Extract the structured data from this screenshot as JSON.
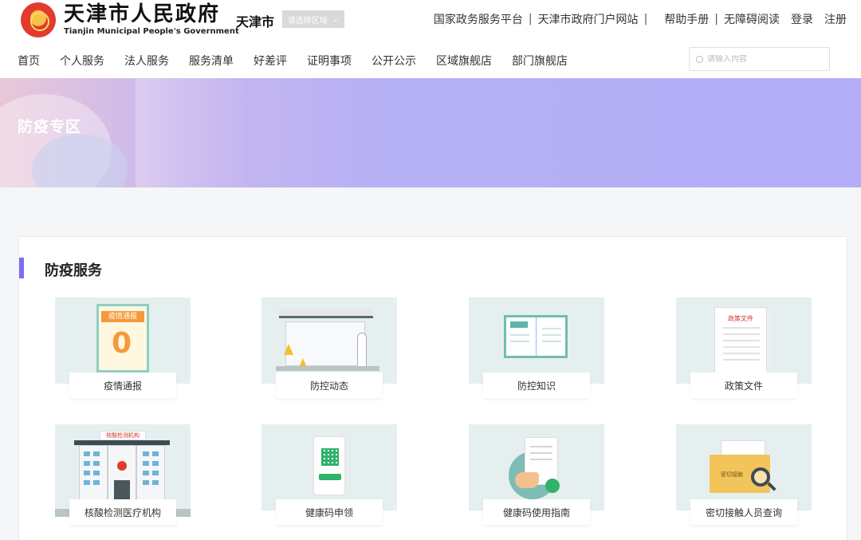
{
  "header": {
    "logo_cn": "天津市人民政府",
    "logo_en": "Tianjin Municipal People's Government",
    "city": "天津市",
    "region_placeholder": "请选择区域",
    "top_links": [
      "国家政务服务平台",
      "天津市政府门户网站",
      "帮助手册",
      "无障碍阅读"
    ],
    "login": "登录",
    "register": "注册",
    "nav": [
      "首页",
      "个人服务",
      "法人服务",
      "服务清单",
      "好差评",
      "证明事项",
      "公开公示",
      "区域旗舰店",
      "部门旗舰店"
    ],
    "search_placeholder": "请输入内容"
  },
  "banner": {
    "title": "防疫专区"
  },
  "section": {
    "title": "防疫服务",
    "cards": [
      {
        "label": "疫情通报",
        "poster_title": "疫情通报",
        "poster_value": "0"
      },
      {
        "label": "防控动态"
      },
      {
        "label": "防控知识"
      },
      {
        "label": "政策文件",
        "doc_title": "政策文件"
      },
      {
        "label": "核酸检测医疗机构",
        "sign_text": "核酸检测机构"
      },
      {
        "label": "健康码申领"
      },
      {
        "label": "健康码使用指南"
      },
      {
        "label": "密切接触人员查询",
        "folder_text": "密切接触"
      }
    ]
  },
  "colors": {
    "accent": "#7b6ef2",
    "card_bg": "#e6efef",
    "banner": "#b4aef8"
  }
}
